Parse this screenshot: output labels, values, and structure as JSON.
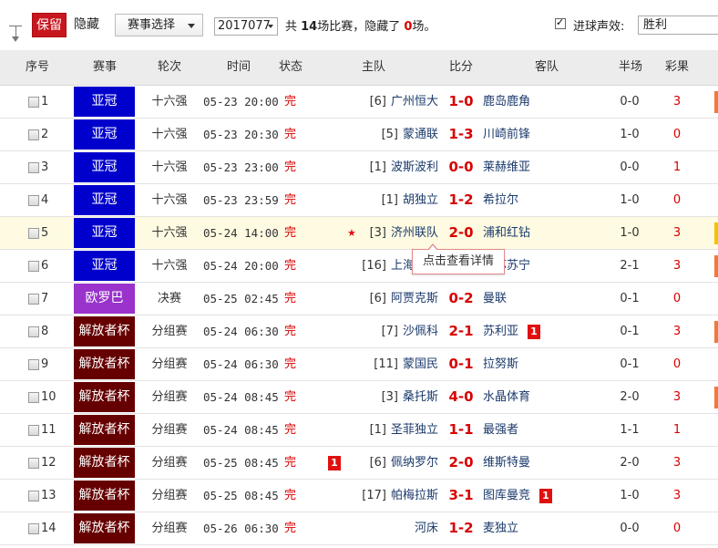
{
  "toolbar": {
    "keep_label": "保留",
    "hide_label": "隐藏",
    "event_select": "赛事选择",
    "period_select": "2017077",
    "summary_prefix": "共 ",
    "total_count": "14",
    "summary_mid": "场比赛，隐藏了 ",
    "hidden_count": "0",
    "summary_suffix": "场。",
    "sound_label": "进球声效:",
    "sound_checked": true,
    "sound_value": "胜利"
  },
  "columns": {
    "idx": "序号",
    "league": "赛事",
    "round": "轮次",
    "time": "时间",
    "status": "状态",
    "home": "主队",
    "score": "比分",
    "away": "客队",
    "half": "半场",
    "lottery": "彩果"
  },
  "colors": {
    "afc": "#0000cc",
    "euro": "#9933cc",
    "liberators": "#660000",
    "red": "#d80000",
    "accent_bar": "#f07a3a",
    "accent_bar_yellow": "#f2c400"
  },
  "matches": [
    {
      "idx": "1",
      "league": "亚冠",
      "league_color": "#0000cc",
      "round": "十六强",
      "time": "05-23 20:00",
      "status": "完",
      "rank": "[6]",
      "home": "广州恒大",
      "score": "1-0",
      "away": "鹿岛鹿角",
      "half": "0-0",
      "lottery": "3",
      "bar": "#f07a3a"
    },
    {
      "idx": "2",
      "league": "亚冠",
      "league_color": "#0000cc",
      "round": "十六强",
      "time": "05-23 20:30",
      "status": "完",
      "rank": "[5]",
      "home": "蒙通联",
      "score": "1-3",
      "away": "川崎前锋",
      "half": "1-0",
      "lottery": "0",
      "bar": ""
    },
    {
      "idx": "3",
      "league": "亚冠",
      "league_color": "#0000cc",
      "round": "十六强",
      "time": "05-23 23:00",
      "status": "完",
      "rank": "[1]",
      "home": "波斯波利",
      "score": "0-0",
      "away": "莱赫维亚",
      "half": "0-0",
      "lottery": "1",
      "bar": ""
    },
    {
      "idx": "4",
      "league": "亚冠",
      "league_color": "#0000cc",
      "round": "十六强",
      "time": "05-23 23:59",
      "status": "完",
      "rank": "[1]",
      "home": "胡独立",
      "score": "1-2",
      "away": "希拉尔",
      "half": "1-0",
      "lottery": "0",
      "bar": ""
    },
    {
      "idx": "5",
      "league": "亚冠",
      "league_color": "#0000cc",
      "round": "十六强",
      "time": "05-24 14:00",
      "status": "完",
      "star": "★",
      "rank": "[3]",
      "home": "济州联队",
      "score": "2-0",
      "away": "浦和红钻",
      "half": "1-0",
      "lottery": "3",
      "bar": "#f2c400",
      "highlight": true
    },
    {
      "idx": "6",
      "league": "亚冠",
      "league_color": "#0000cc",
      "round": "十六强",
      "time": "05-24 20:00",
      "status": "完",
      "rank": "[16]",
      "home": "上海上港",
      "score": "",
      "away": "江苏苏宁",
      "half": "2-1",
      "lottery": "3",
      "bar": "#f07a3a"
    },
    {
      "idx": "7",
      "league": "欧罗巴",
      "league_color": "#9933cc",
      "round": "决赛",
      "time": "05-25 02:45",
      "status": "完",
      "rank": "[6]",
      "home": "阿贾克斯",
      "score": "0-2",
      "away": "曼联",
      "half": "0-1",
      "lottery": "0",
      "bar": ""
    },
    {
      "idx": "8",
      "league": "解放者杯",
      "league_color": "#660000",
      "round": "分组赛",
      "time": "05-24 06:30",
      "status": "完",
      "rank": "[7]",
      "home": "沙佩科",
      "score": "2-1",
      "away": "苏利亚",
      "away_card": "1",
      "half": "0-1",
      "lottery": "3",
      "bar": "#f07a3a"
    },
    {
      "idx": "9",
      "league": "解放者杯",
      "league_color": "#660000",
      "round": "分组赛",
      "time": "05-24 06:30",
      "status": "完",
      "rank": "[11]",
      "home": "蒙国民",
      "score": "0-1",
      "away": "拉努斯",
      "half": "0-1",
      "lottery": "0",
      "bar": ""
    },
    {
      "idx": "10",
      "league": "解放者杯",
      "league_color": "#660000",
      "round": "分组赛",
      "time": "05-24 08:45",
      "status": "完",
      "rank": "[3]",
      "home": "桑托斯",
      "score": "4-0",
      "away": "水晶体育",
      "half": "2-0",
      "lottery": "3",
      "bar": "#f07a3a"
    },
    {
      "idx": "11",
      "league": "解放者杯",
      "league_color": "#660000",
      "round": "分组赛",
      "time": "05-24 08:45",
      "status": "完",
      "rank": "[1]",
      "home": "圣菲独立",
      "score": "1-1",
      "away": "最强者",
      "half": "1-1",
      "lottery": "1",
      "bar": ""
    },
    {
      "idx": "12",
      "league": "解放者杯",
      "league_color": "#660000",
      "round": "分组赛",
      "time": "05-25 08:45",
      "status": "完",
      "home_card": "1",
      "rank": "[6]",
      "home": "佩纳罗尔",
      "score": "2-0",
      "away": "维斯特曼",
      "half": "2-0",
      "lottery": "3",
      "bar": ""
    },
    {
      "idx": "13",
      "league": "解放者杯",
      "league_color": "#660000",
      "round": "分组赛",
      "time": "05-25 08:45",
      "status": "完",
      "rank": "[17]",
      "home": "帕梅拉斯",
      "score": "3-1",
      "away": "图库曼竞",
      "away_card": "1",
      "half": "1-0",
      "lottery": "3",
      "bar": ""
    },
    {
      "idx": "14",
      "league": "解放者杯",
      "league_color": "#660000",
      "round": "分组赛",
      "time": "05-26 06:30",
      "status": "完",
      "rank": "",
      "home": "河床",
      "score": "1-2",
      "away": "麦独立",
      "half": "0-0",
      "lottery": "0",
      "bar": ""
    }
  ],
  "tooltip": "点击查看详情"
}
